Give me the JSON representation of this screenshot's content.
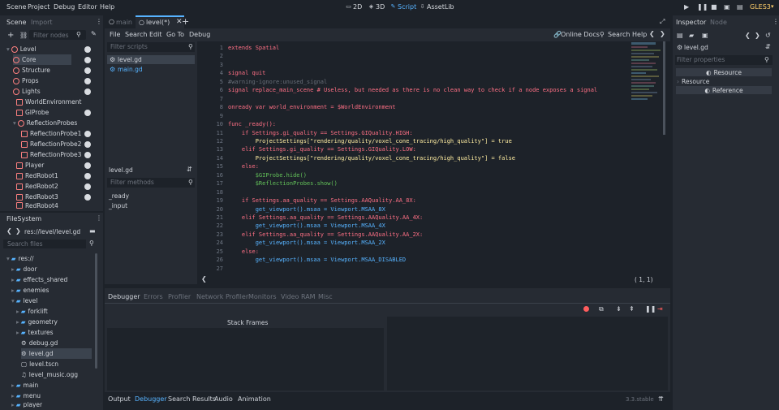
{
  "menu": {
    "items": [
      "Scene",
      "Project",
      "Debug",
      "Editor",
      "Help"
    ]
  },
  "workspaces": {
    "items": [
      "2D",
      "3D",
      "Script",
      "AssetLib"
    ],
    "active": "Script"
  },
  "renderer": "GLES3",
  "scene_panel": {
    "tabs": [
      "Scene",
      "Import"
    ],
    "filter_placeholder": "Filter nodes",
    "nodes": [
      "Level",
      "Core",
      "Structure",
      "Props",
      "Lights",
      "WorldEnvironment",
      "GIProbe",
      "ReflectionProbes",
      "ReflectionProbe1",
      "ReflectionProbe2",
      "ReflectionProbe3",
      "Player",
      "RedRobot1",
      "RedRobot2",
      "RedRobot3",
      "RedRobot4"
    ]
  },
  "filesystem": {
    "title": "FileSystem",
    "path": "res://level/level.gd",
    "search_placeholder": "Search files",
    "items": [
      "res://",
      "door",
      "effects_shared",
      "enemies",
      "level",
      "forklift",
      "geometry",
      "textures",
      "debug.gd",
      "level.gd",
      "level.tscn",
      "level_music.ogg",
      "main",
      "menu",
      "player"
    ]
  },
  "script_tabs": [
    "main",
    "level(*)"
  ],
  "script_menu": [
    "File",
    "Search",
    "Edit",
    "Go To",
    "Debug"
  ],
  "online_docs": "Online Docs",
  "search_help": "Search Help",
  "scripts_filter_placeholder": "Filter scripts",
  "scripts": [
    "level.gd",
    "main.gd"
  ],
  "current_script": "level.gd",
  "methods_filter_placeholder": "Filter methods",
  "methods": [
    "_ready",
    "_input"
  ],
  "code": {
    "line_numbers": [
      "1",
      "2",
      "3",
      "4",
      "5",
      "6",
      "7",
      "8",
      "9",
      "10",
      "11",
      "12",
      "13",
      "14",
      "15",
      "16",
      "17",
      "18",
      "19",
      "20",
      "21",
      "22",
      "23",
      "24",
      "25",
      "26",
      "27"
    ],
    "lines": [
      "extends Spatial",
      "",
      "",
      "signal quit",
      "#warning-ignore:unused_signal",
      "signal replace_main_scene # Useless, but needed as there is no clean way to check if a node exposes a signal",
      "",
      "onready var world_environment = $WorldEnvironment",
      "",
      "func _ready():",
      "    if Settings.gi_quality == Settings.GIQuality.HIGH:",
      "        ProjectSettings[\"rendering/quality/voxel_cone_tracing/high_quality\"] = true",
      "    elif Settings.gi_quality == Settings.GIQuality.LOW:",
      "        ProjectSettings[\"rendering/quality/voxel_cone_tracing/high_quality\"] = false",
      "    else:",
      "        $GIProbe.hide()",
      "        $ReflectionProbes.show()",
      "",
      "    if Settings.aa_quality == Settings.AAQuality.AA_8X:",
      "        get_viewport().msaa = Viewport.MSAA_8X",
      "    elif Settings.aa_quality == Settings.AAQuality.AA_4X:",
      "        get_viewport().msaa = Viewport.MSAA_4X",
      "    elif Settings.aa_quality == Settings.AAQuality.AA_2X:",
      "        get_viewport().msaa = Viewport.MSAA_2X",
      "    else:",
      "        get_viewport().msaa = Viewport.MSAA_DISABLED",
      ""
    ],
    "cursor": "(   1,   1)"
  },
  "debugger_tabs": [
    "Debugger",
    "Errors",
    "Profiler",
    "Network Profiler",
    "Monitors",
    "Video RAM",
    "Misc"
  ],
  "stack_frames": "Stack Frames",
  "bottom_tabs": [
    "Output",
    "Debugger",
    "Search Results",
    "Audio",
    "Animation"
  ],
  "version": "3.3.stable",
  "inspector": {
    "tabs": [
      "Inspector",
      "Node"
    ],
    "resource": "level.gd",
    "filter_placeholder": "Filter properties",
    "buttons": [
      "Resource",
      "Resource",
      "Reference"
    ]
  },
  "colors": {
    "accent": "#57b3ff",
    "bg": "#1d2229",
    "panel": "#262b33"
  }
}
